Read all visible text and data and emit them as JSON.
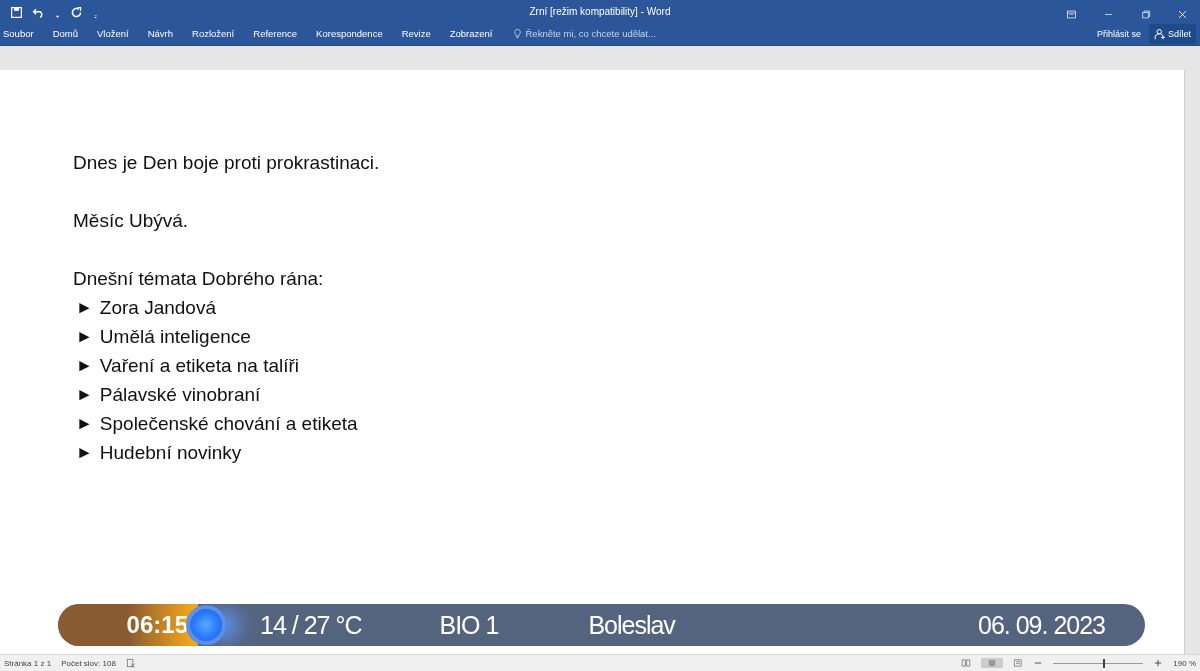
{
  "window": {
    "title": "Zrní [režim kompatibility] - Word"
  },
  "account": {
    "sign_in": "Přihlásit se",
    "share": "Sdílet"
  },
  "ribbon_tabs": [
    {
      "label": "Soubor",
      "selected": false
    },
    {
      "label": "Domů",
      "selected": false
    },
    {
      "label": "Vložení",
      "selected": false
    },
    {
      "label": "Návrh",
      "selected": false
    },
    {
      "label": "Rozložení",
      "selected": false
    },
    {
      "label": "Reference",
      "selected": false
    },
    {
      "label": "Korespondence",
      "selected": false
    },
    {
      "label": "Revize",
      "selected": false
    },
    {
      "label": "Zobrazení",
      "selected": false
    }
  ],
  "tell_me": {
    "placeholder": "Řekněte mi, co chcete udělat..."
  },
  "document": {
    "paragraphs": [
      {
        "kind": "text",
        "text": "Dnes je Den boje proti prokrastinaci."
      },
      {
        "kind": "blank"
      },
      {
        "kind": "text",
        "text": "Měsíc Ubývá."
      },
      {
        "kind": "blank"
      },
      {
        "kind": "text",
        "text": "Dnešní témata Dobrého rána:"
      },
      {
        "kind": "bullet",
        "marker": "►",
        "text": "Zora Jandová"
      },
      {
        "kind": "bullet",
        "marker": "►",
        "text": "Umělá inteligence"
      },
      {
        "kind": "bullet",
        "marker": "►",
        "text": "Vaření a etiketa na talíři"
      },
      {
        "kind": "bullet",
        "marker": "►",
        "text": "Pálavské vinobraní"
      },
      {
        "kind": "bullet",
        "marker": "►",
        "text": "Společenské chování a etiketa"
      },
      {
        "kind": "bullet",
        "marker": "►",
        "text": "Hudební novinky"
      }
    ]
  },
  "ticker": {
    "time": "06:15",
    "temperature": "14 / 27 °C",
    "program": "BIO 1",
    "place": "Boleslav",
    "date": "06. 09. 2023"
  },
  "status_bar": {
    "page": "Stránka 1 z 1",
    "words": "Počet slov: 108",
    "zoom": "190 %",
    "zoom_level": {
      "level": 0.55
    }
  }
}
